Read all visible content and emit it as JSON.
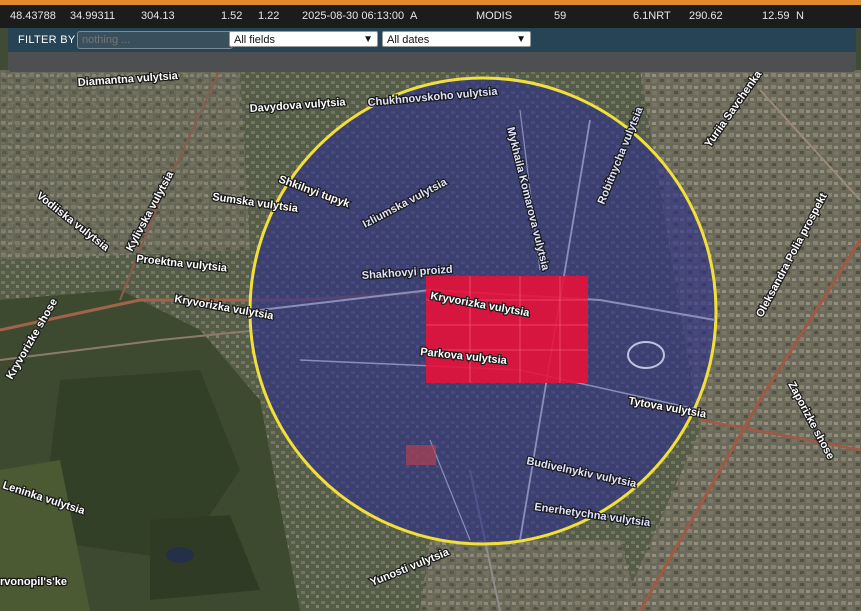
{
  "data_row": {
    "latitude": "48.43788",
    "longitude": "34.99311",
    "brightness": "304.13",
    "scan": "1.52",
    "track": "1.22",
    "acq_datetime": "2025-08-30 06:13:00",
    "satellite": "A",
    "instrument": "MODIS",
    "confidence": "59",
    "version": "6.1NRT",
    "bright_t31": "290.62",
    "frp": "12.59",
    "daynight": "N"
  },
  "filter": {
    "label": "FILTER BY",
    "search_placeholder": "nothing ...",
    "field_select": "All fields",
    "date_select": "All dates"
  },
  "colors": {
    "accent": "#e08a2a",
    "circle": "#f2e03a",
    "highlight": "#e8123a",
    "circle_fill": "#2b2f8a"
  },
  "map": {
    "street_labels": [
      "Diamantna vulytsia",
      "Davydova vulytsia",
      "Chukhnovskoho vulytsia",
      "Mykhaila Komarova vulytsia",
      "Robitnycha vulytsia",
      "Yuriia Savchenka vulytsia",
      "Oleksandra Polia prospekt",
      "Shkilnyi tupyk",
      "Izliumska vulytsia",
      "Sumska vulytsia",
      "Kylivska vulytsia",
      "Vodiiska vulytsia",
      "Proektna vulytsia",
      "Shakhovyi proizd",
      "Kryvorizka vulytsia",
      "Kryvorizka vulytsia",
      "Parkova vulytsia",
      "Kryvorizke shose",
      "Tytova vulytsia",
      "Zaporizke shose",
      "Budivelnykiv vulytsia",
      "Enerhetychna vulytsia",
      "Yunosti vulytsia",
      "Leninka vulytsia",
      "rvonopil's'ke"
    ]
  }
}
